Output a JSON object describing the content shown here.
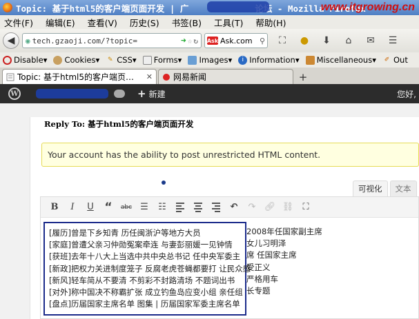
{
  "window": {
    "title": "Topic: 基于html5的客户端页面开发 | 广",
    "title_suffix": "论坛 - Mozilla Firefox",
    "watermark": "www.itgrowing.cn"
  },
  "menu": [
    "文件(F)",
    "编辑(E)",
    "查看(V)",
    "历史(S)",
    "书签(B)",
    "工具(T)",
    "帮助(H)"
  ],
  "nav": {
    "url": "tech.gzaoji.com/?topic=",
    "search_engine": "Ask.com",
    "icons": [
      "back-icon",
      "globe-icon",
      "go-icon",
      "star-icon",
      "reload-icon",
      "ask-icon",
      "search-icon",
      "screenshot-icon",
      "addon-icon",
      "home-icon",
      "mail-icon",
      "download-icon"
    ]
  },
  "devbar": [
    "Disable",
    "Cookies",
    "CSS",
    "Forms",
    "Images",
    "Information",
    "Miscellaneous",
    "Out"
  ],
  "tabs": [
    {
      "label": "Topic: 基于html5的客户端页…",
      "active": true
    },
    {
      "label": "网易新闻",
      "active": false
    }
  ],
  "adminbar": {
    "new_label": "新建",
    "howdy": "您好,"
  },
  "page": {
    "reply_title": "Reply To: 基于html5的客户端页面开发",
    "notice": "Your account has the ability to post unrestricted HTML content."
  },
  "editor": {
    "tabs": [
      "可视化",
      "文本"
    ],
    "toolbar": [
      "bold",
      "italic",
      "underline",
      "blockquote",
      "strikethrough",
      "bullet-list",
      "numbered-list",
      "align-left",
      "align-center",
      "align-right",
      "undo",
      "redo",
      "link",
      "unlink",
      "fullscreen"
    ],
    "lines": [
      "[履历]曾是下乡知青 历任闽浙沪等地方大员",
      "[家庭]曾遭父亲习仲勋冤案牵连 与妻彭丽媛一见钟情",
      "[获班]去年十八大上当选中共中央总书记 任中央军委主",
      "[新政]把权力关进制度笼子 反腐老虎苍蝇都要打 让民众感",
      "[新风]轻车简从不要清 不剪彩不封路清场 不题词出书",
      "[对外]称中国决不称霸扩张 成立钓鱼岛应变小组 亲任组",
      "[盘点]历届国家主席名单 图集 | 历届国家军委主席名单"
    ],
    "overflow": [
      "2008年任国家副主席",
      "女儿习明泽",
      "席 任国家主席",
      "受正义",
      "严格用车",
      "长专题",
      ""
    ]
  }
}
